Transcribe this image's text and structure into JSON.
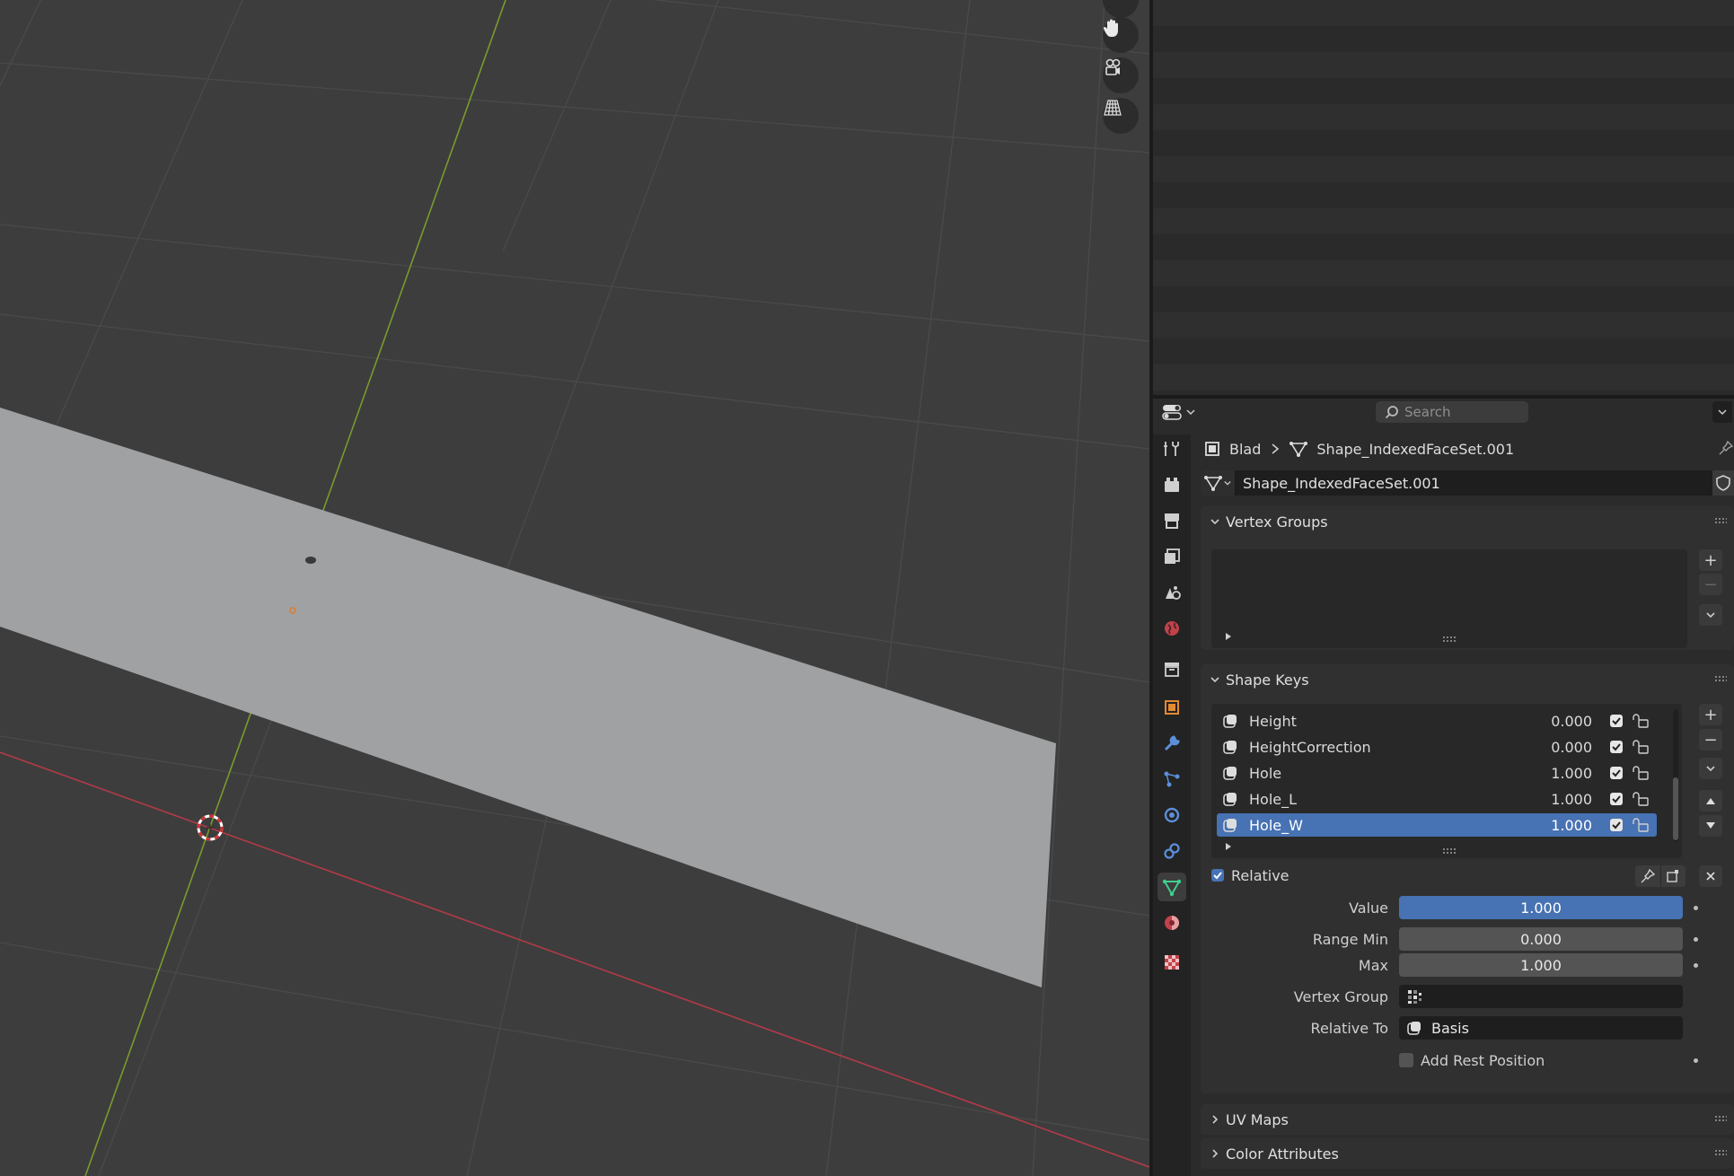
{
  "outliner": {},
  "viewport": {
    "nav": [
      "zoom-icon",
      "pan-hand-icon",
      "camera-view-icon",
      "ortho-grid-icon"
    ]
  },
  "properties": {
    "search": {
      "placeholder": "Search"
    },
    "breadcrumb": {
      "object": "Blad",
      "mesh": "Shape_IndexedFaceSet.001"
    },
    "datablock_name": "Shape_IndexedFaceSet.001",
    "tabs": [
      "tool",
      "render",
      "output",
      "view-layer",
      "scene",
      "world",
      "collection",
      "object",
      "modifiers",
      "particles",
      "physics",
      "constraints",
      "data",
      "material",
      "texture"
    ],
    "active_tab": "data",
    "vertex_groups": {
      "title": "Vertex Groups"
    },
    "shape_keys": {
      "title": "Shape Keys",
      "items": [
        {
          "name": "Height",
          "value": "0.000"
        },
        {
          "name": "HeightCorrection",
          "value": "0.000"
        },
        {
          "name": "Hole",
          "value": "1.000"
        },
        {
          "name": "Hole_L",
          "value": "1.000"
        },
        {
          "name": "Hole_W",
          "value": "1.000",
          "selected": true
        }
      ],
      "relative_label": "Relative",
      "relative_checked": true,
      "value_label": "Value",
      "value": "1.000",
      "range_min_label": "Range Min",
      "range_min": "0.000",
      "max_label": "Max",
      "max": "1.000",
      "vertex_group_label": "Vertex Group",
      "vertex_group": "",
      "relative_to_label": "Relative To",
      "relative_to": "Basis",
      "add_rest_label": "Add Rest Position",
      "add_rest_checked": false
    },
    "uv_maps": {
      "title": "UV Maps"
    },
    "color_attributes": {
      "title": "Color Attributes"
    }
  },
  "colors": {
    "accent": "#4772b3",
    "x_axis": "#b33a48",
    "y_axis": "#7a9a2e",
    "plane": "#9fa1a3"
  }
}
